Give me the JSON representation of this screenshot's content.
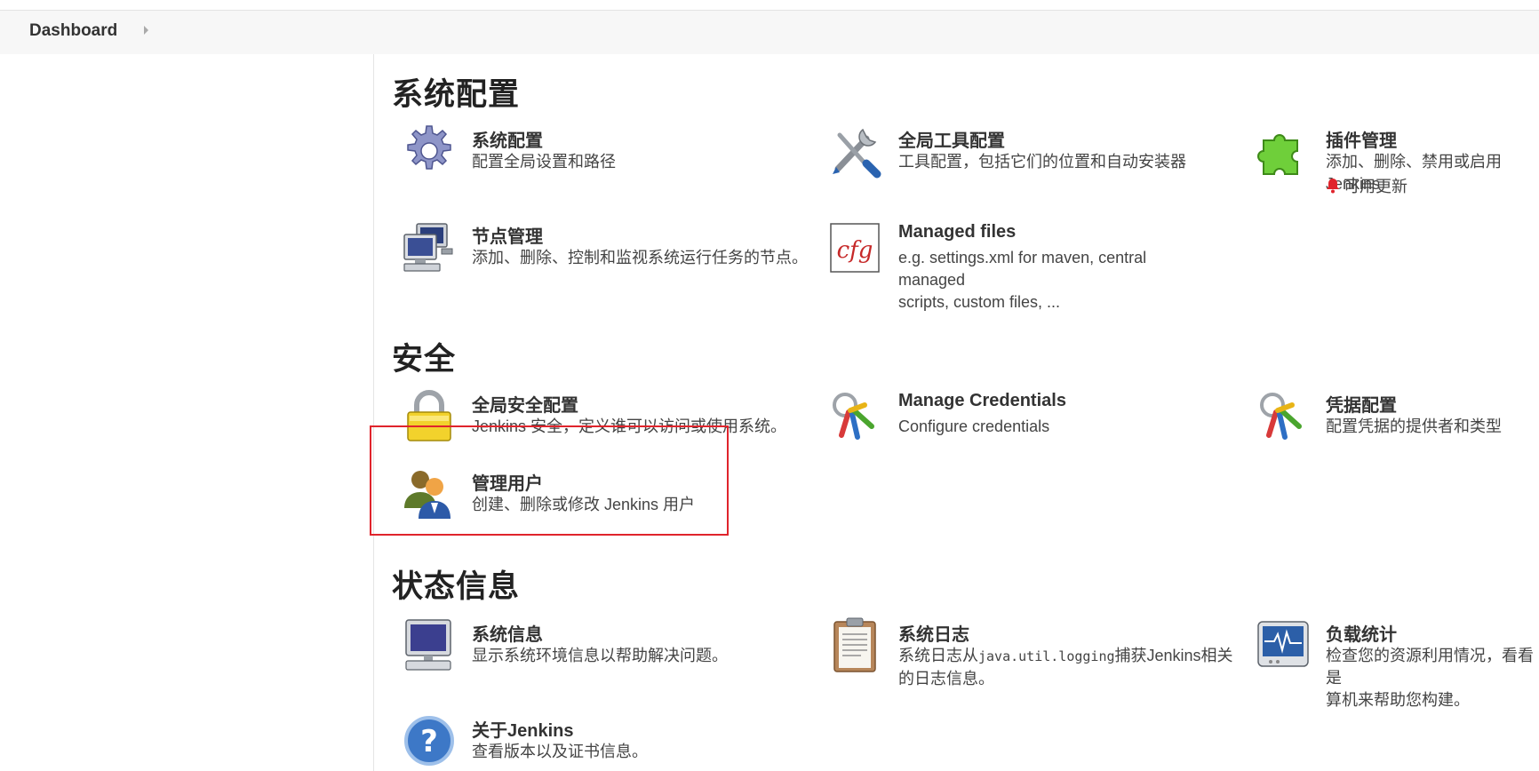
{
  "breadcrumb": {
    "label": "Dashboard"
  },
  "sections": {
    "system": {
      "title": "系统配置",
      "items": [
        {
          "name": "系统配置",
          "desc": "配置全局设置和路径",
          "icon": "gear-icon"
        },
        {
          "name": "全局工具配置",
          "desc": "工具配置，包括它们的位置和自动安装器",
          "icon": "tools-icon"
        },
        {
          "name": "插件管理",
          "desc": "添加、删除、禁用或启用Jenkins",
          "update": "可用更新",
          "icon": "puzzle-icon"
        },
        {
          "name": "节点管理",
          "desc": "添加、删除、控制和监视系统运行任务的节点。",
          "icon": "computers-icon"
        },
        {
          "name": "Managed files",
          "desc_line1": "e.g. settings.xml for maven, central managed",
          "desc_line2": "scripts, custom files, ...",
          "icon": "cfg-icon"
        }
      ]
    },
    "security": {
      "title": "安全",
      "items": [
        {
          "name": "全局安全配置",
          "desc": "Jenkins 安全，定义谁可以访问或使用系统。",
          "icon": "lock-icon"
        },
        {
          "name": "Manage Credentials",
          "desc": "Configure credentials",
          "icon": "keys-icon"
        },
        {
          "name": "凭据配置",
          "desc": "配置凭据的提供者和类型",
          "icon": "keys-icon"
        },
        {
          "name": "管理用户",
          "desc": "创建、删除或修改 Jenkins 用户",
          "icon": "users-icon"
        }
      ]
    },
    "status": {
      "title": "状态信息",
      "items": [
        {
          "name": "系统信息",
          "desc": "显示系统环境信息以帮助解决问题。",
          "icon": "monitor-icon"
        },
        {
          "name": "系统日志",
          "desc_pre": "系统日志从",
          "desc_code": "java.util.logging",
          "desc_post": "捕获Jenkins相关",
          "desc_line2": "的日志信息。",
          "icon": "clipboard-icon"
        },
        {
          "name": "负载统计",
          "desc_line1": "检查您的资源利用情况，看看是",
          "desc_line2": "算机来帮助您构建。",
          "icon": "heartbeat-icon"
        },
        {
          "name": "关于Jenkins",
          "desc": "查看版本以及证书信息。",
          "icon": "help-icon"
        }
      ]
    }
  },
  "colors": {
    "highlight": "#e0242c",
    "bell": "#e0242c"
  }
}
